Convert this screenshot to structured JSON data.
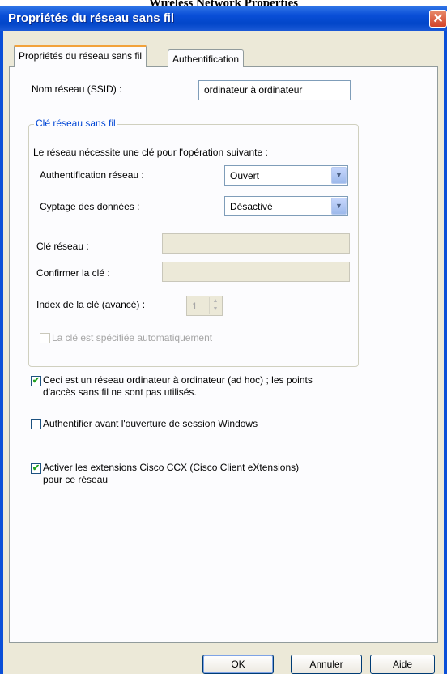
{
  "heading": "Wireless Network Properties",
  "window": {
    "title": "Propriétés du réseau sans fil"
  },
  "tabs": [
    {
      "label": "Propriétés du réseau sans fil",
      "active": true
    },
    {
      "label": "Authentification",
      "active": false
    }
  ],
  "ssid": {
    "label": "Nom réseau (SSID) :",
    "value": "ordinateur à ordinateur"
  },
  "key_group": {
    "title": "Clé réseau sans fil",
    "intro": "Le réseau nécessite une clé pour l'opération suivante :",
    "auth": {
      "label": "Authentification réseau :",
      "value": "Ouvert"
    },
    "encryption": {
      "label": "Cyptage des données :",
      "value": "Désactivé"
    },
    "network_key": {
      "label": "Clé réseau :",
      "value": ""
    },
    "confirm_key": {
      "label": "Confirmer la clé :",
      "value": ""
    },
    "key_index": {
      "label": "Index de la clé (avancé) :",
      "value": "1"
    },
    "auto_key": {
      "label": "La clé est spécifiée automatiquement",
      "checked": false
    }
  },
  "adhoc": {
    "line1": "Ceci est un réseau ordinateur à ordinateur (ad hoc) ; les points",
    "line2": "d'accès sans fil ne sont pas utilisés.",
    "checked": true
  },
  "auth_before_logon": {
    "label": "Authentifier avant l'ouverture de session Windows",
    "checked": false
  },
  "cisco_ccx": {
    "line1": "Activer les extensions Cisco CCX (Cisco Client eXtensions)",
    "line2": "pour ce réseau",
    "checked": true
  },
  "buttons": {
    "ok": "OK",
    "cancel": "Annuler",
    "help": "Aide"
  },
  "icons": {
    "close": "✕",
    "dropdown": "▼",
    "spin_up": "▲",
    "spin_down": "▼",
    "check": "✔"
  },
  "colors": {
    "title_bar": "#0a4fd8",
    "tab_highlight": "#f2a23a",
    "group_title": "#0046d5",
    "check": "#21a121"
  }
}
